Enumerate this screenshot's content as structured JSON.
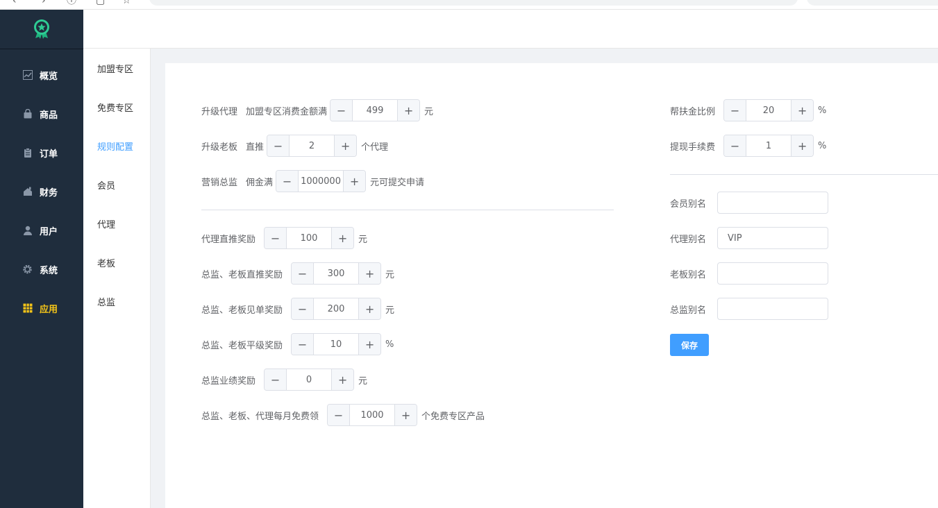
{
  "sidebar": {
    "items": [
      {
        "label": "概览",
        "icon": "chart-icon",
        "active": false
      },
      {
        "label": "商品",
        "icon": "bag-icon",
        "active": false
      },
      {
        "label": "订单",
        "icon": "clipboard-icon",
        "active": false
      },
      {
        "label": "财务",
        "icon": "finance-icon",
        "active": false
      },
      {
        "label": "用户",
        "icon": "user-icon",
        "active": false
      },
      {
        "label": "系统",
        "icon": "gear-icon",
        "active": false
      },
      {
        "label": "应用",
        "icon": "grid-icon",
        "active": true
      }
    ],
    "accent_color": "#f5c518",
    "background_color": "#1f2d3d"
  },
  "submenu": {
    "items": [
      {
        "label": "加盟专区",
        "active": false
      },
      {
        "label": "免费专区",
        "active": false
      },
      {
        "label": "规则配置",
        "active": true
      },
      {
        "label": "会员",
        "active": false
      },
      {
        "label": "代理",
        "active": false
      },
      {
        "label": "老板",
        "active": false
      },
      {
        "label": "总监",
        "active": false
      }
    ],
    "active_color": "#409eff"
  },
  "form": {
    "upgrade_agent": {
      "label": "升级代理",
      "prefix": "加盟专区消费金额满",
      "value": "499",
      "suffix": "元"
    },
    "upgrade_boss": {
      "label": "升级老板",
      "prefix": "直推",
      "value": "2",
      "suffix": "个代理"
    },
    "marketing_director": {
      "label": "营销总监",
      "prefix": "佣金满",
      "value": "1000000",
      "suffix": "元可提交申请"
    },
    "agent_direct_reward": {
      "label": "代理直推奖励",
      "value": "100",
      "suffix": "元"
    },
    "boss_direct_reward": {
      "label": "总监、老板直推奖励",
      "value": "300",
      "suffix": "元"
    },
    "boss_order_reward": {
      "label": "总监、老板见单奖励",
      "value": "200",
      "suffix": "元"
    },
    "boss_level_reward": {
      "label": "总监、老板平级奖励",
      "value": "10",
      "suffix": "%"
    },
    "director_perf_reward": {
      "label": "总监业绩奖励",
      "value": "0",
      "suffix": "元"
    },
    "monthly_free": {
      "label": "总监、老板、代理每月免费领",
      "value": "1000",
      "suffix": "个免费专区产品"
    },
    "support_ratio": {
      "label": "帮扶金比例",
      "value": "20",
      "suffix": "%"
    },
    "withdraw_fee": {
      "label": "提现手续费",
      "value": "1",
      "suffix": "%"
    },
    "aliases": {
      "member": {
        "label": "会员别名",
        "value": ""
      },
      "agent": {
        "label": "代理别名",
        "value": "VIP"
      },
      "boss": {
        "label": "老板别名",
        "value": ""
      },
      "director": {
        "label": "总监别名",
        "value": ""
      }
    },
    "save_label": "保存"
  },
  "stepper": {
    "minus_glyph": "−",
    "plus_glyph": "+"
  },
  "colors": {
    "primary": "#409eff",
    "content_bg": "#f0f2f5",
    "border": "#dcdfe6"
  }
}
